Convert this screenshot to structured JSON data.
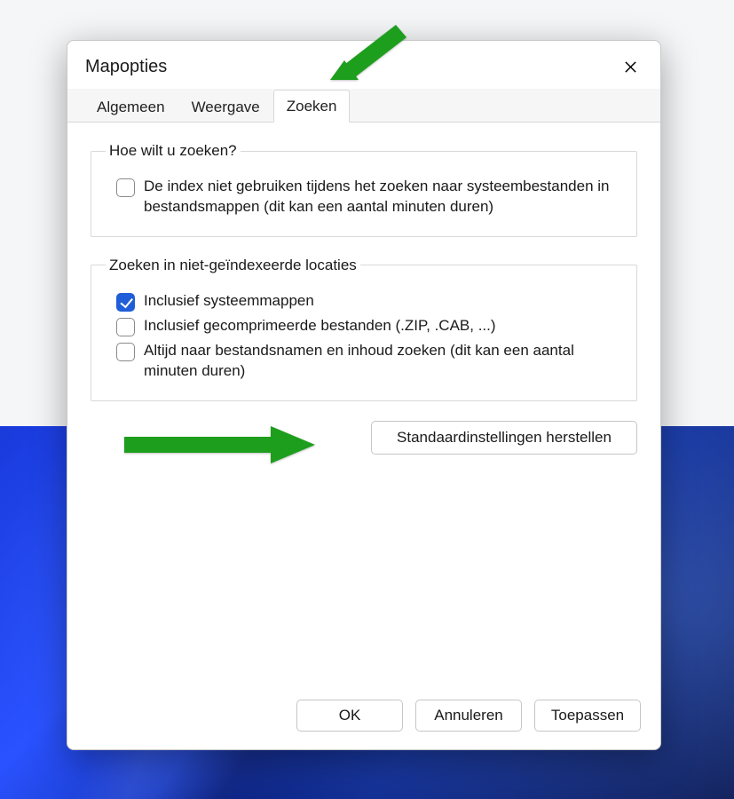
{
  "dialog": {
    "title": "Mapopties"
  },
  "tabs": {
    "general": "Algemeen",
    "view": "Weergave",
    "search": "Zoeken"
  },
  "group1": {
    "legend": "Hoe wilt u zoeken?",
    "opt_noindex": "De index niet gebruiken tijdens het zoeken naar systeembestanden in bestandsmappen (dit kan een aantal minuten duren)"
  },
  "group2": {
    "legend": "Zoeken in niet-geïndexeerde locaties",
    "opt_sysfolders": "Inclusief systeemmappen",
    "opt_compressed": "Inclusief gecomprimeerde bestanden (.ZIP, .CAB, ...)",
    "opt_filenames": "Altijd naar bestandsnamen en inhoud zoeken (dit kan een aantal minuten duren)"
  },
  "buttons": {
    "restore_defaults": "Standaardinstellingen herstellen",
    "ok": "OK",
    "cancel": "Annuleren",
    "apply": "Toepassen"
  },
  "state": {
    "active_tab": "search",
    "noindex_checked": false,
    "sysfolders_checked": true,
    "compressed_checked": false,
    "filenames_checked": false
  }
}
